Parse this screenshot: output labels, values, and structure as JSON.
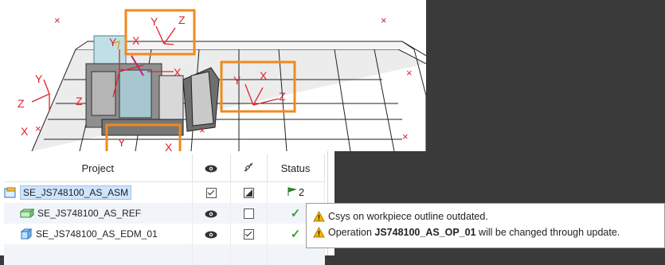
{
  "viewport": {
    "axis_labels": {
      "top_y": "Y",
      "top_z": "Z",
      "top_x": "X",
      "right_y": "Y",
      "right_x": "X",
      "right_z": "Z",
      "left_y": "Y",
      "left_z": "Z",
      "left_x": "X",
      "origin_z": "Z",
      "origin_y": "Y",
      "origin_x": "X",
      "bottom_y": "Y",
      "bottom_x": "X"
    },
    "highlight_color": "#f08a1c",
    "axis_color": "#e0202a"
  },
  "tree": {
    "columns": {
      "project": "Project",
      "visibility": "visibility-icon",
      "link": "link-icon",
      "status": "Status"
    },
    "rows": [
      {
        "name": "SE_JS748100_AS_ASM",
        "icon": "assembly-icon",
        "visibility": "checked",
        "link": "partial",
        "status": "flag",
        "status_count": "2"
      },
      {
        "name": "SE_JS748100_AS_REF",
        "icon": "reference-part-icon",
        "visibility": "eye",
        "link": "unchecked",
        "status": "ok"
      },
      {
        "name": "SE_JS748100_AS_EDM_01",
        "icon": "part-icon",
        "visibility": "eye",
        "link": "checked",
        "status": "ok"
      }
    ]
  },
  "tooltip": {
    "line1": "Csys on workpiece outline outdated.",
    "line2_pre": "Operation ",
    "line2_bold": "JS748100_AS_OP_01",
    "line2_post": " will be changed through update."
  }
}
